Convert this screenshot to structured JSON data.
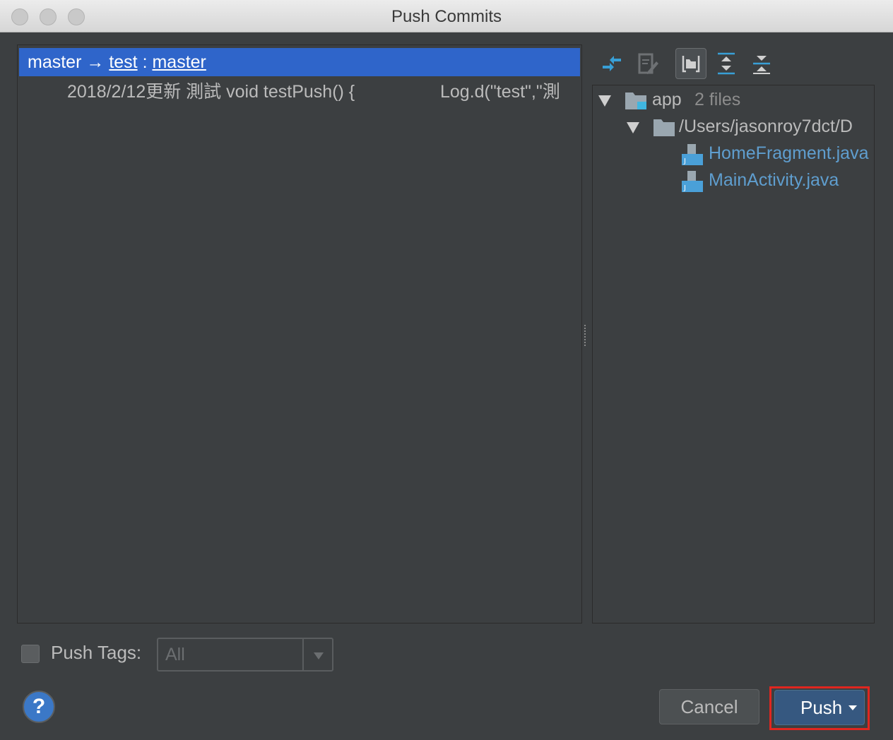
{
  "window": {
    "title": "Push Commits"
  },
  "commits": {
    "branch": {
      "local": "master",
      "arrow": "→",
      "remote": "test",
      "separator": ":",
      "remote_branch": "master"
    },
    "items": [
      {
        "message": "2018/2/12更新 測試  void testPush() {",
        "message_cont": "Log.d(\"test\",\"測"
      }
    ]
  },
  "toolbar": {
    "icons": [
      "expand-collapse-icon",
      "edit-source-icon",
      "group-by-directory-icon",
      "expand-all-icon",
      "collapse-all-icon"
    ]
  },
  "tree": {
    "root": {
      "label": "app",
      "count": "2 files"
    },
    "folder": {
      "label": "/Users/jasonroy7dct/D"
    },
    "files": [
      "HomeFragment.java",
      "MainActivity.java"
    ]
  },
  "push_tags": {
    "label": "Push Tags:",
    "checked": false,
    "value": "All"
  },
  "buttons": {
    "help": "?",
    "cancel": "Cancel",
    "push": "Push"
  },
  "colors": {
    "selection": "#2f65ca",
    "push_button": "#365880",
    "highlight_frame": "#e0261f",
    "java_file": "#5f9ecf"
  }
}
